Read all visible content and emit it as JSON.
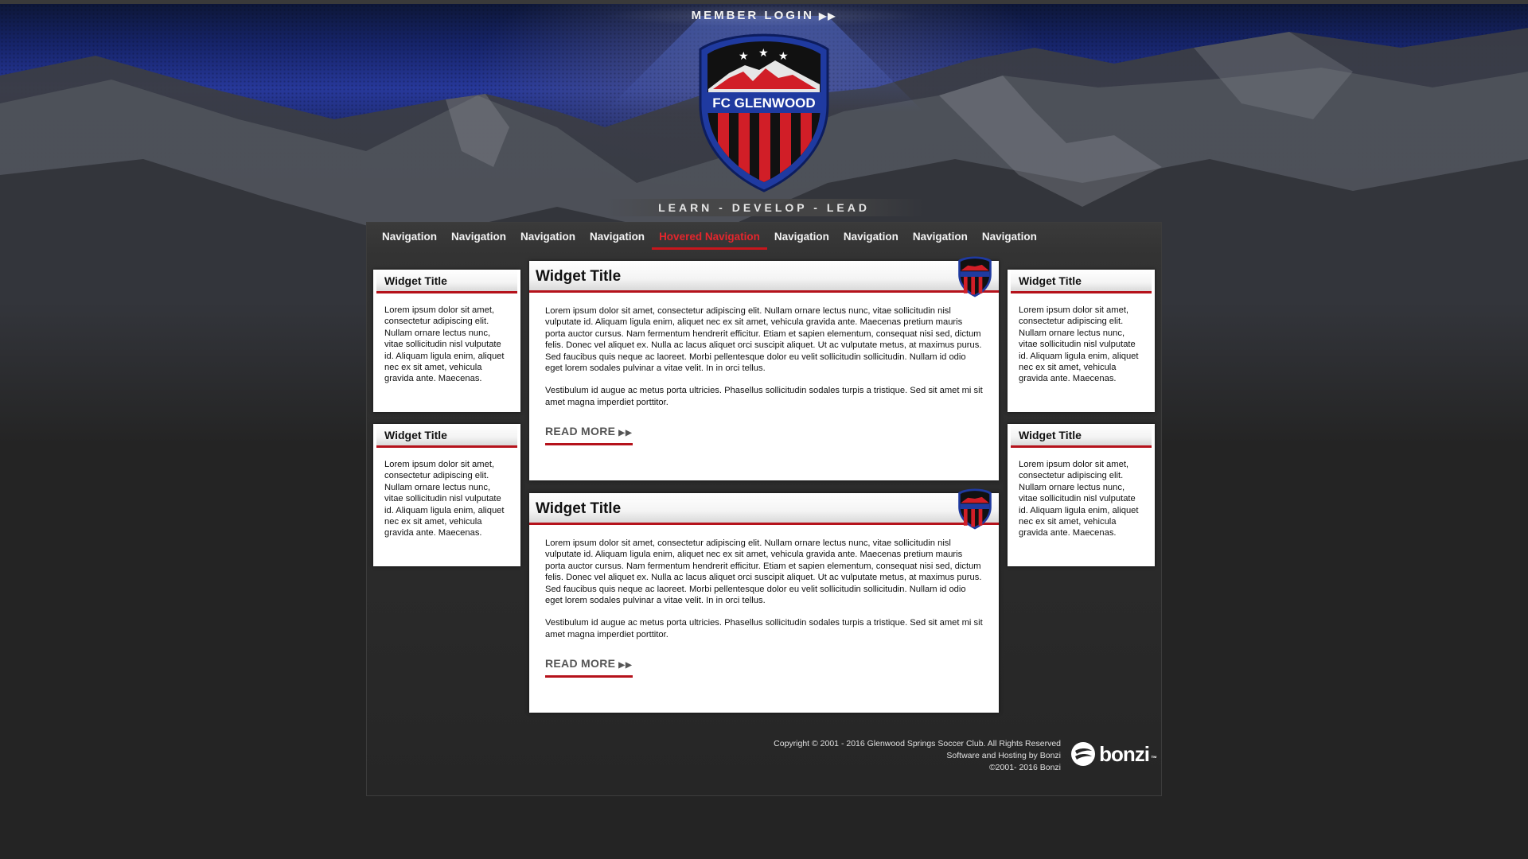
{
  "header": {
    "member_login": "MEMBER LOGIN",
    "member_login_arrows": "▶▶",
    "crest_name": "FC GLENWOOD",
    "tagline": "LEARN - DEVELOP - LEAD"
  },
  "nav": {
    "items": [
      {
        "label": "Navigation"
      },
      {
        "label": "Navigation"
      },
      {
        "label": "Navigation"
      },
      {
        "label": "Navigation"
      },
      {
        "label": "Hovered Navigation"
      },
      {
        "label": "Navigation"
      },
      {
        "label": "Navigation"
      },
      {
        "label": "Navigation"
      },
      {
        "label": "Navigation"
      }
    ]
  },
  "left_widgets": [
    {
      "title": "Widget Title",
      "body": "Lorem ipsum dolor sit amet, consectetur adipiscing elit. Nullam ornare lectus nunc, vitae sollicitudin nisl vulputate id. Aliquam ligula enim, aliquet nec ex sit amet, vehicula gravida ante. Maecenas."
    },
    {
      "title": "Widget Title",
      "body": "Lorem ipsum dolor sit amet, consectetur adipiscing elit. Nullam ornare lectus nunc, vitae sollicitudin nisl vulputate id. Aliquam ligula enim, aliquet nec ex sit amet, vehicula gravida ante. Maecenas."
    }
  ],
  "right_widgets": [
    {
      "title": "Widget Title",
      "body": "Lorem ipsum dolor sit amet, consectetur adipiscing elit. Nullam ornare lectus nunc, vitae sollicitudin nisl vulputate id. Aliquam ligula enim, aliquet nec ex sit amet, vehicula gravida ante. Maecenas."
    },
    {
      "title": "Widget Title",
      "body": "Lorem ipsum dolor sit amet, consectetur adipiscing elit. Nullam ornare lectus nunc, vitae sollicitudin nisl vulputate id. Aliquam ligula enim, aliquet nec ex sit amet, vehicula gravida ante. Maecenas."
    }
  ],
  "main_widgets": [
    {
      "title": "Widget Title",
      "paragraph1": "Lorem ipsum dolor sit amet, consectetur adipiscing elit. Nullam ornare lectus nunc, vitae sollicitudin nisl vulputate id. Aliquam ligula enim, aliquet nec ex sit amet, vehicula gravida ante. Maecenas pretium mauris porta auctor cursus. Nam fermentum hendrerit efficitur. Etiam et sapien elementum, consequat nisi sed, dictum felis. Donec vel aliquet ex. Nulla ac lacus aliquet orci suscipit aliquet. Ut ac vulputate metus, at maximus purus. Sed faucibus quis neque ac laoreet. Morbi pellentesque dolor eu velit sollicitudin sollicitudin. Nullam id odio eget lorem sodales pulvinar a vitae velit. In in orci tellus.",
      "paragraph2": "Vestibulum id augue ac metus porta ultricies. Phasellus sollicitudin sodales turpis a tristique. Sed sit amet mi sit amet magna imperdiet porttitor.",
      "read_more": "READ MORE",
      "read_more_arrows": "▶▶"
    },
    {
      "title": "Widget Title",
      "paragraph1": "Lorem ipsum dolor sit amet, consectetur adipiscing elit. Nullam ornare lectus nunc, vitae sollicitudin nisl vulputate id. Aliquam ligula enim, aliquet nec ex sit amet, vehicula gravida ante. Maecenas pretium mauris porta auctor cursus. Nam fermentum hendrerit efficitur. Etiam et sapien elementum, consequat nisi sed, dictum felis. Donec vel aliquet ex. Nulla ac lacus aliquet orci suscipit aliquet. Ut ac vulputate metus, at maximus purus. Sed faucibus quis neque ac laoreet. Morbi pellentesque dolor eu velit sollicitudin sollicitudin. Nullam id odio eget lorem sodales pulvinar a vitae velit. In in orci tellus.",
      "paragraph2": "Vestibulum id augue ac metus porta ultricies. Phasellus sollicitudin sodales turpis a tristique. Sed sit amet mi sit amet magna imperdiet porttitor.",
      "read_more": "READ MORE",
      "read_more_arrows": "▶▶"
    }
  ],
  "footer": {
    "copyright": "Copyright © 2001 - 2016 Glenwood Springs Soccer Club.  All Rights Reserved",
    "hosting": "Software and Hosting by Bonzi",
    "bonzi_copyright": "©2001- 2016 Bonzi",
    "bonzi_logo": "bonzi",
    "bonzi_tm": "™"
  },
  "colors": {
    "accent_red": "#b5121b",
    "hover_red": "#e4262d",
    "crest_blue": "#1f3aa0"
  }
}
